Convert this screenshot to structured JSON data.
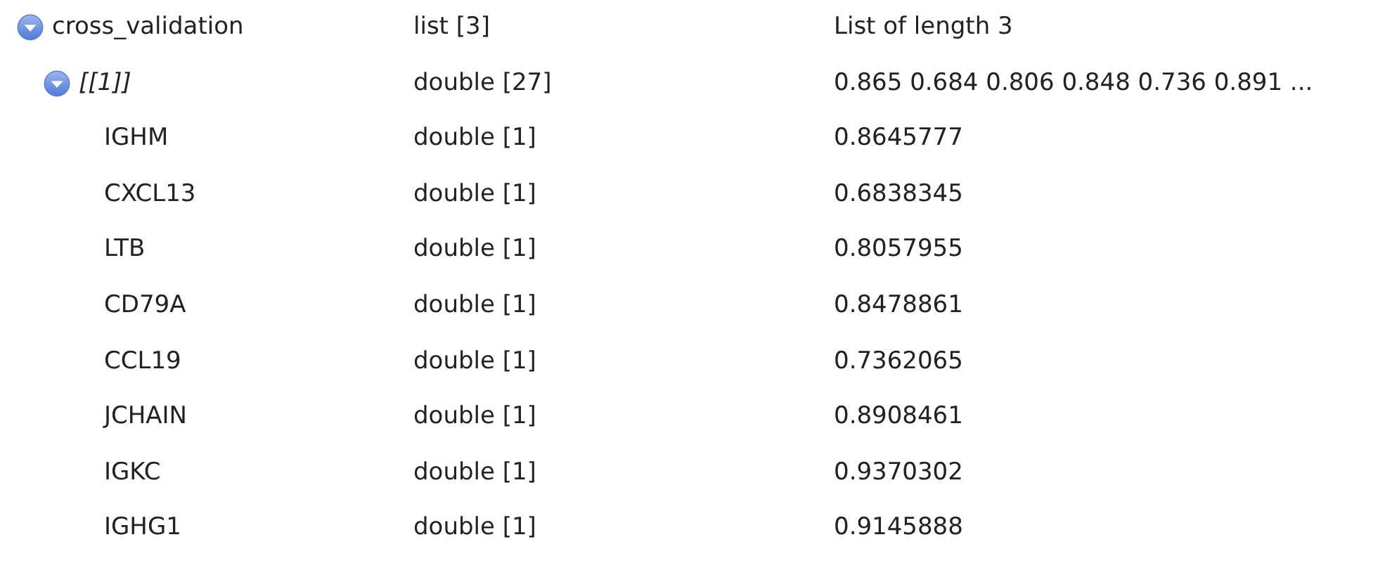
{
  "tree": [
    {
      "name": "cross_validation",
      "kind": "list",
      "type": "list [3]",
      "value": "List of length 3",
      "expanded": true,
      "children": [
        {
          "name": "[[1]]",
          "kind": "element",
          "type": "double [27]",
          "value": "0.865 0.684 0.806 0.848 0.736 0.891 ...",
          "expanded": true,
          "children": [
            {
              "name": "IGHM",
              "kind": "leaf",
              "type": "double [1]",
              "value": "0.8645777"
            },
            {
              "name": "CXCL13",
              "kind": "leaf",
              "type": "double [1]",
              "value": "0.6838345"
            },
            {
              "name": "LTB",
              "kind": "leaf",
              "type": "double [1]",
              "value": "0.8057955"
            },
            {
              "name": "CD79A",
              "kind": "leaf",
              "type": "double [1]",
              "value": "0.8478861"
            },
            {
              "name": "CCL19",
              "kind": "leaf",
              "type": "double [1]",
              "value": "0.7362065"
            },
            {
              "name": "JCHAIN",
              "kind": "leaf",
              "type": "double [1]",
              "value": "0.8908461"
            },
            {
              "name": "IGKC",
              "kind": "leaf",
              "type": "double [1]",
              "value": "0.9370302"
            },
            {
              "name": "IGHG1",
              "kind": "leaf",
              "type": "double [1]",
              "value": "0.9145888"
            }
          ]
        }
      ]
    }
  ]
}
